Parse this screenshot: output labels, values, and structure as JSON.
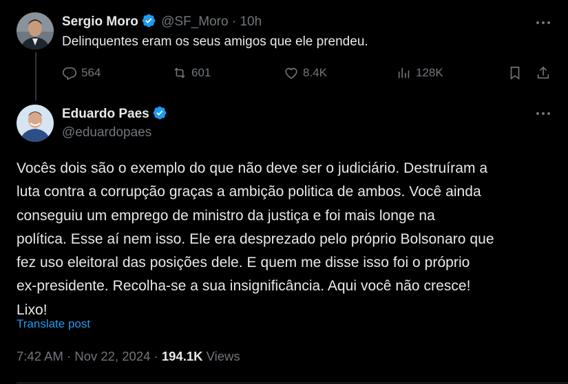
{
  "reply_tweet": {
    "display_name": "Sergio Moro",
    "handle": "@SF_Moro",
    "separator": "·",
    "time": "10h",
    "text": "Delinquentes eram os seus amigos que ele prendeu.",
    "replies": "564",
    "reposts": "601",
    "likes": "8.4K",
    "views": "128K",
    "avatar_icon": "person-avatar-icon"
  },
  "main_tweet": {
    "display_name": "Eduardo Paes",
    "handle": "@eduardopaes",
    "text_lines": [
      "Vocês dois são o exemplo do que não deve ser o judiciário. Destruíram a",
      "luta contra a corrupção graças a ambição politica de ambos. Você ainda",
      "conseguiu um emprego de ministro da justiça e foi mais longe na",
      "política. Esse aí nem isso. Ele era desprezado pelo próprio Bolsonaro que",
      "fez uso eleitoral das posições dele. E quem me disse isso foi o próprio",
      "ex-presidente. Recolha-se a sua insignificância. Aqui você não cresce!",
      "Lixo!"
    ],
    "translate_label": "Translate post",
    "time": "7:42 AM",
    "separator": "·",
    "date": "Nov 22, 2024",
    "dot": "·",
    "views_count": "194.1K",
    "views_label": "Views"
  },
  "colors": {
    "background": "#000000",
    "text": "#e7e9ea",
    "muted": "#71767b",
    "accent": "#1d9bf0",
    "verified": "#1d9bf0"
  }
}
